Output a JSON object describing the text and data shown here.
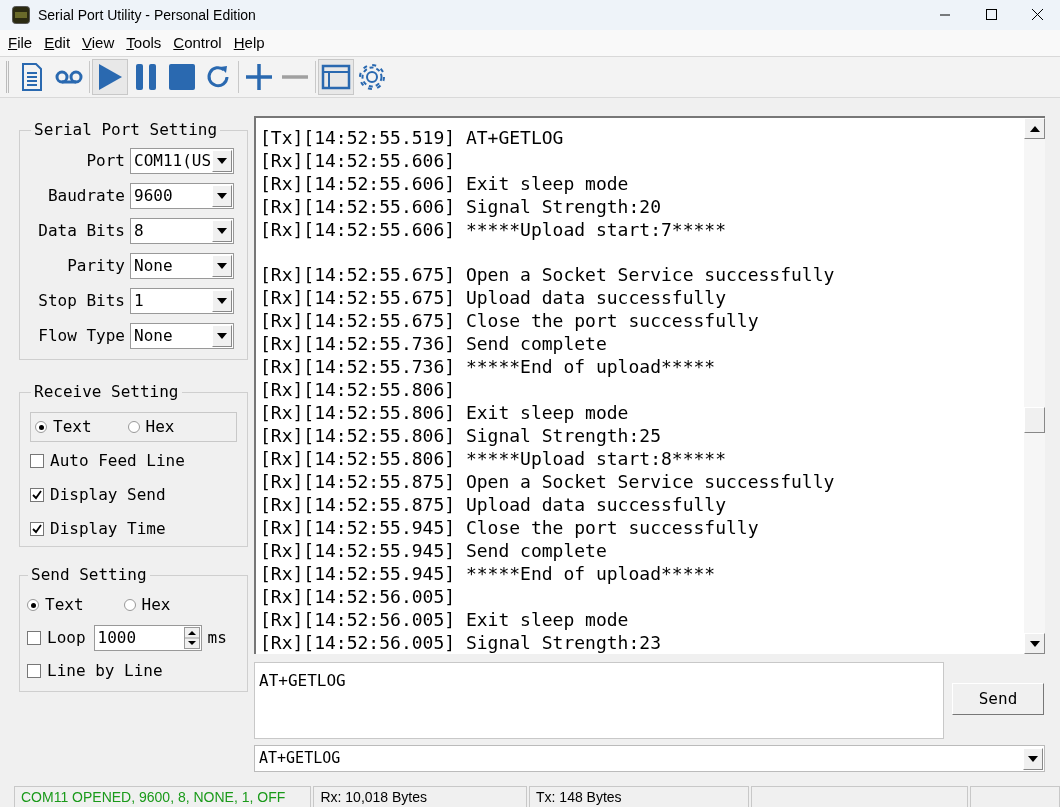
{
  "window": {
    "title": "Serial Port Utility - Personal Edition"
  },
  "menu": [
    "File",
    "Edit",
    "View",
    "Tools",
    "Control",
    "Help"
  ],
  "toolbar": [
    {
      "kind": "new",
      "pressed": false
    },
    {
      "kind": "record",
      "pressed": false
    },
    {
      "kind": "play",
      "pressed": true
    },
    {
      "kind": "pause",
      "pressed": false
    },
    {
      "kind": "stop",
      "pressed": false
    },
    {
      "kind": "refresh",
      "pressed": false
    },
    {
      "kind": "add",
      "pressed": false
    },
    {
      "kind": "remove",
      "pressed": false
    },
    {
      "kind": "window",
      "pressed": true
    },
    {
      "kind": "settings",
      "pressed": false
    }
  ],
  "serial_port_setting": {
    "title": "Serial Port Setting",
    "fields": [
      {
        "label": "Port",
        "value": "COM11(US"
      },
      {
        "label": "Baudrate",
        "value": "9600"
      },
      {
        "label": "Data Bits",
        "value": "8"
      },
      {
        "label": "Parity",
        "value": "None"
      },
      {
        "label": "Stop Bits",
        "value": "1"
      },
      {
        "label": "Flow Type",
        "value": "None"
      }
    ]
  },
  "receive_setting": {
    "title": "Receive Setting",
    "format": [
      {
        "label": "Text",
        "selected": true
      },
      {
        "label": "Hex",
        "selected": false
      }
    ],
    "options": [
      {
        "label": "Auto Feed Line",
        "checked": false
      },
      {
        "label": "Display Send",
        "checked": true
      },
      {
        "label": "Display Time",
        "checked": true
      }
    ]
  },
  "send_setting": {
    "title": "Send Setting",
    "format": [
      {
        "label": "Text",
        "selected": true
      },
      {
        "label": "Hex",
        "selected": false
      }
    ],
    "loop": {
      "label": "Loop",
      "checked": false,
      "value": "1000",
      "unit": "ms"
    },
    "line_by_line": {
      "label": "Line by Line",
      "checked": false
    }
  },
  "log": [
    "[Tx][14:52:55.519] AT+GETLOG",
    "[Rx][14:52:55.606]",
    "[Rx][14:52:55.606] Exit sleep mode",
    "[Rx][14:52:55.606] Signal Strength:20",
    "[Rx][14:52:55.606] *****Upload start:7*****",
    {
      "kind": "blank"
    },
    "[Rx][14:52:55.675] Open a Socket Service successfully",
    "[Rx][14:52:55.675] Upload data successfully",
    "[Rx][14:52:55.675] Close the port successfully",
    "[Rx][14:52:55.736] Send complete",
    "[Rx][14:52:55.736] *****End of upload*****",
    "[Rx][14:52:55.806]",
    "[Rx][14:52:55.806] Exit sleep mode",
    "[Rx][14:52:55.806] Signal Strength:25",
    "[Rx][14:52:55.806] *****Upload start:8*****",
    "[Rx][14:52:55.875] Open a Socket Service successfully",
    "[Rx][14:52:55.875] Upload data successfully",
    "[Rx][14:52:55.945] Close the port successfully",
    "[Rx][14:52:55.945] Send complete",
    "[Rx][14:52:55.945] *****End of upload*****",
    "[Rx][14:52:56.005]",
    "[Rx][14:52:56.005] Exit sleep mode",
    "[Rx][14:52:56.005] Signal Strength:23"
  ],
  "send_input": {
    "value": "AT+GETLOG"
  },
  "send_button": "Send",
  "history": {
    "value": "AT+GETLOG"
  },
  "status_bar": [
    {
      "kind": "status",
      "text": "COM11 OPENED, 9600, 8, NONE, 1, OFF"
    },
    {
      "kind": "plain",
      "text": "Rx: 10,018 Bytes"
    },
    {
      "kind": "plain",
      "text": "Tx: 148 Bytes"
    },
    {
      "kind": "empty"
    },
    {
      "kind": "empty"
    }
  ]
}
